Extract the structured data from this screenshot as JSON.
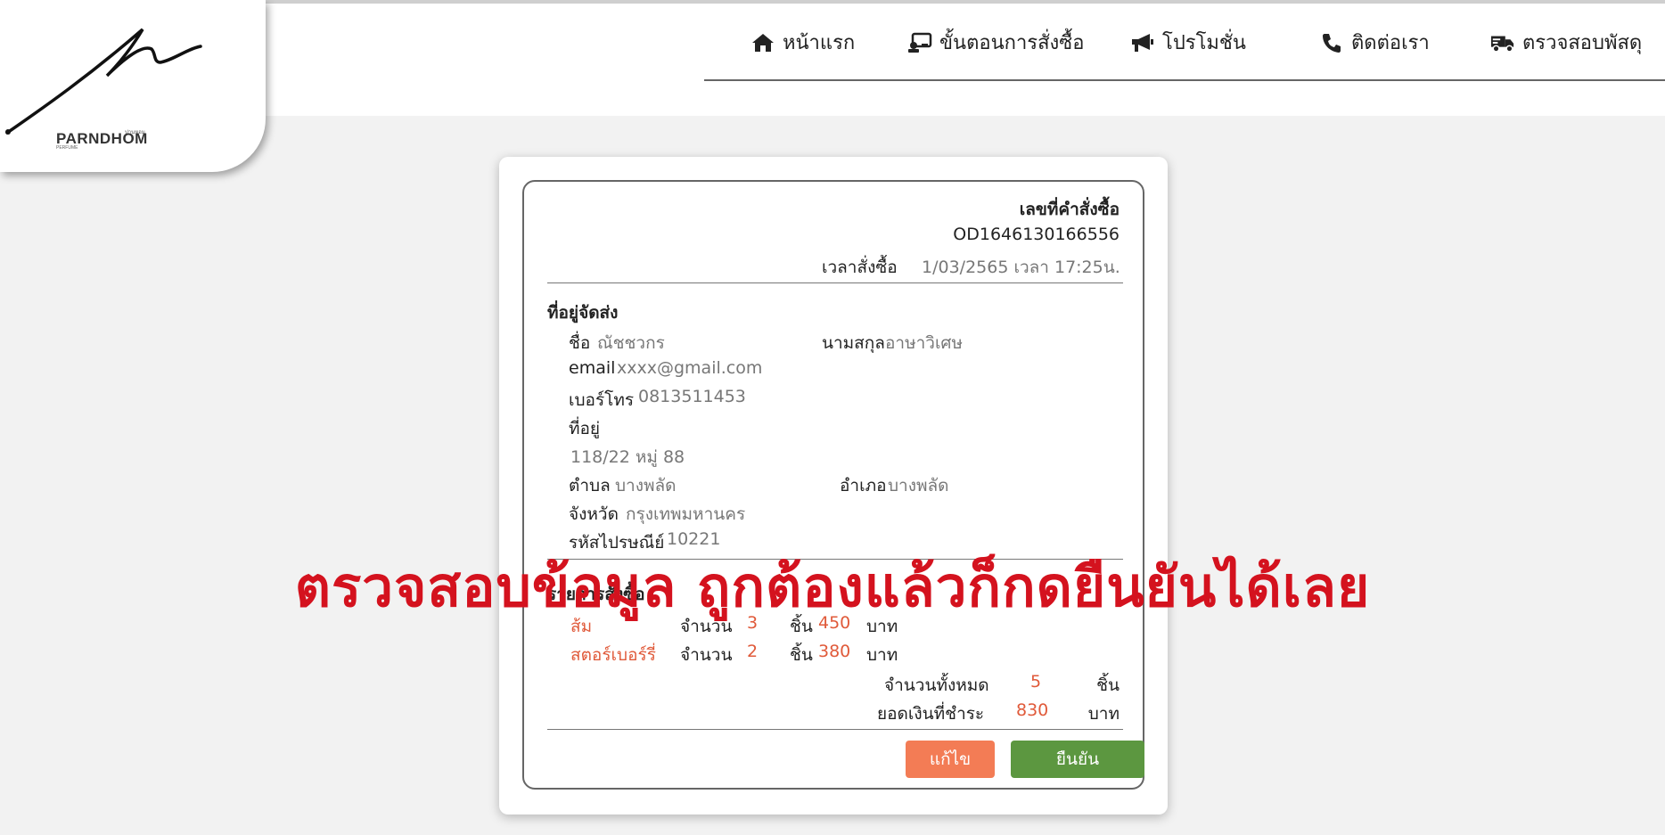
{
  "brand": {
    "name": "PARNDHOM",
    "sub_top": "ปานหอม",
    "sub_bottom": "PERFUME"
  },
  "nav": [
    {
      "label": "หน้าแรก",
      "icon": "home-icon"
    },
    {
      "label": "ขั้นตอนการสั่งซื้อ",
      "icon": "order-steps-icon"
    },
    {
      "label": "โปรโมชั่น",
      "icon": "megaphone-icon"
    },
    {
      "label": "ติดต่อเรา",
      "icon": "phone-icon"
    },
    {
      "label": "ตรวจสอบพัสดุ",
      "icon": "truck-icon"
    }
  ],
  "order": {
    "number_label": "เลขที่คำสั่งซื้อ",
    "number": "OD1646130166556",
    "time_label": "เวลาสั่งซื้อ",
    "time_value": "1/03/2565 เวลา 17:25น."
  },
  "shipping": {
    "title": "ที่อยู่จัดส่ง",
    "first_name_label": "ชื่อ",
    "first_name": "ณัชชวกร",
    "last_name_label": "นามสกุล",
    "last_name": "อาษาวิเศษ",
    "email_label": "email",
    "email": "xxxx@gmail.com",
    "phone_label": "เบอร์โทร",
    "phone": "0813511453",
    "address_label": "ที่อยู่",
    "address": "118/22 หมู่ 88",
    "subdistrict_label": "ตำบล",
    "subdistrict": "บางพลัด",
    "district_label": "อำเภอ",
    "district": "บางพลัด",
    "province_label": "จังหวัด",
    "province": "กรุงเทพมหานคร",
    "postcode_label": "รหัสไปรษณีย์",
    "postcode": "10221"
  },
  "items_section": {
    "title": "รายการสั่งซื้อ",
    "qty_label": "จำนวน",
    "unit_piece": "ชิ้น",
    "unit_baht": "บาท",
    "items": [
      {
        "name": "ส้ม",
        "qty": "3",
        "price": "450"
      },
      {
        "name": "สตอร์เบอร์รี่",
        "qty": "2",
        "price": "380"
      }
    ],
    "total_qty_label": "จำนวนทั้งหมด",
    "total_qty": "5",
    "total_amount_label": "ยอดเงินที่ชำระ",
    "total_amount": "830"
  },
  "buttons": {
    "edit": "แก้ไข",
    "confirm": "ยืนยัน"
  },
  "overlay_text": "ตรวจสอบข้อมูล ถูกต้องแล้วก็กดยืนยันได้เลย",
  "colors": {
    "accent_red": "#e05a3a",
    "edit_button": "#f37c55",
    "confirm_button": "#5c9740",
    "overlay": "#d4121e"
  }
}
